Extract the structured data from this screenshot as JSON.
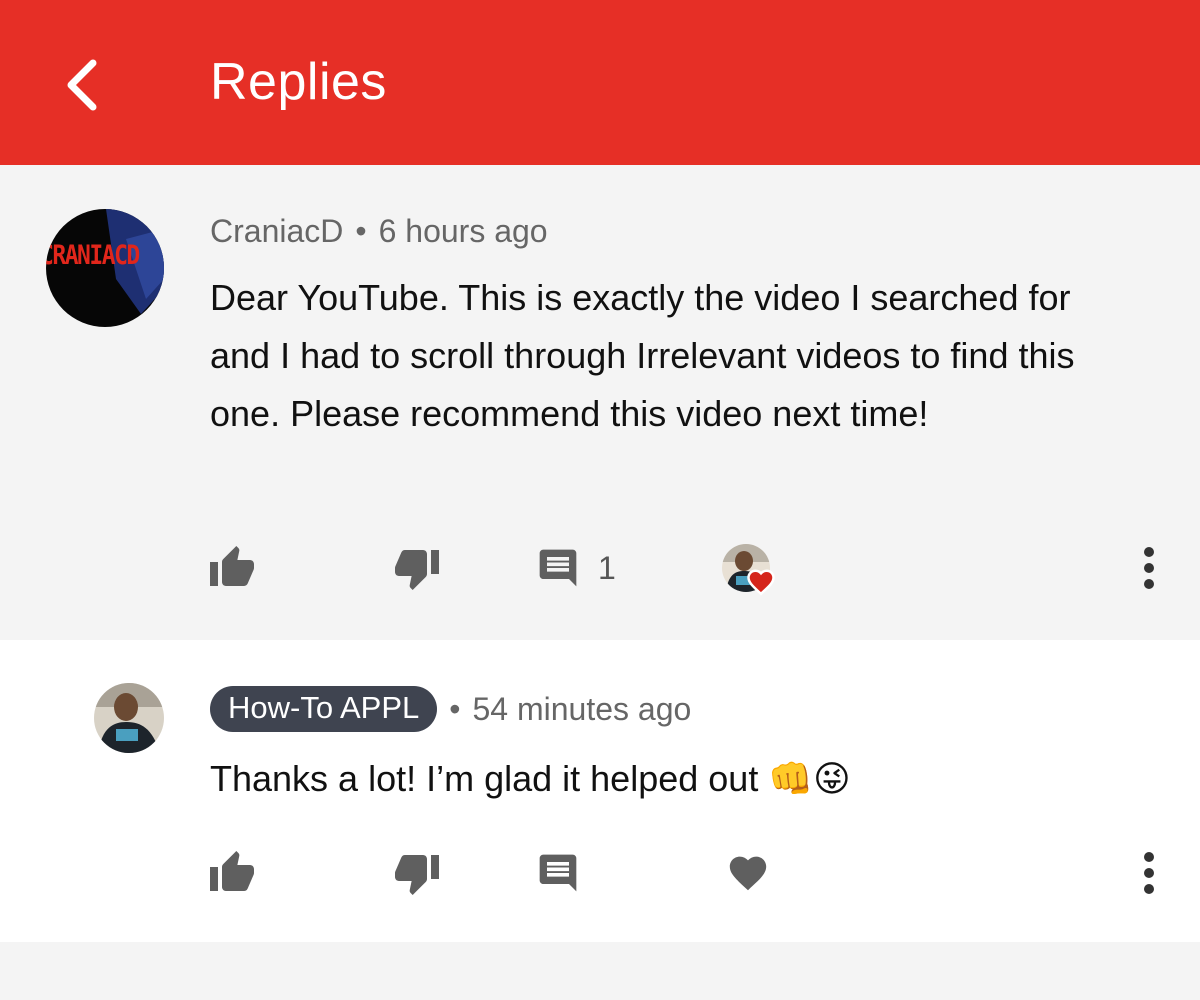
{
  "header": {
    "title": "Replies",
    "back_icon": "back-arrow-icon"
  },
  "comment": {
    "author": "CraniacD",
    "separator": "•",
    "time": "6 hours ago",
    "avatar_text": "CRANIACD",
    "text": "Dear YouTube. This is exactly the video I searched for and I had to scroll through Irrelevant videos to find this one. Please recommend this video next time!",
    "reply_count": "1",
    "icons": [
      "thumbs-up-icon",
      "thumbs-down-icon",
      "reply-icon",
      "creator-heart-icon",
      "more-vertical-icon"
    ]
  },
  "reply": {
    "author": "How-To APPL",
    "separator": "•",
    "time": "54 minutes ago",
    "text": "Thanks a lot! I’m glad it helped out",
    "emoji": "👊😜",
    "icons": [
      "thumbs-up-icon",
      "thumbs-down-icon",
      "reply-icon",
      "heart-icon",
      "more-vertical-icon"
    ]
  },
  "colors": {
    "brand": "#e62f26",
    "badge": "#3f4450",
    "icon": "#5f5f5f",
    "heart": "#d5251b"
  }
}
